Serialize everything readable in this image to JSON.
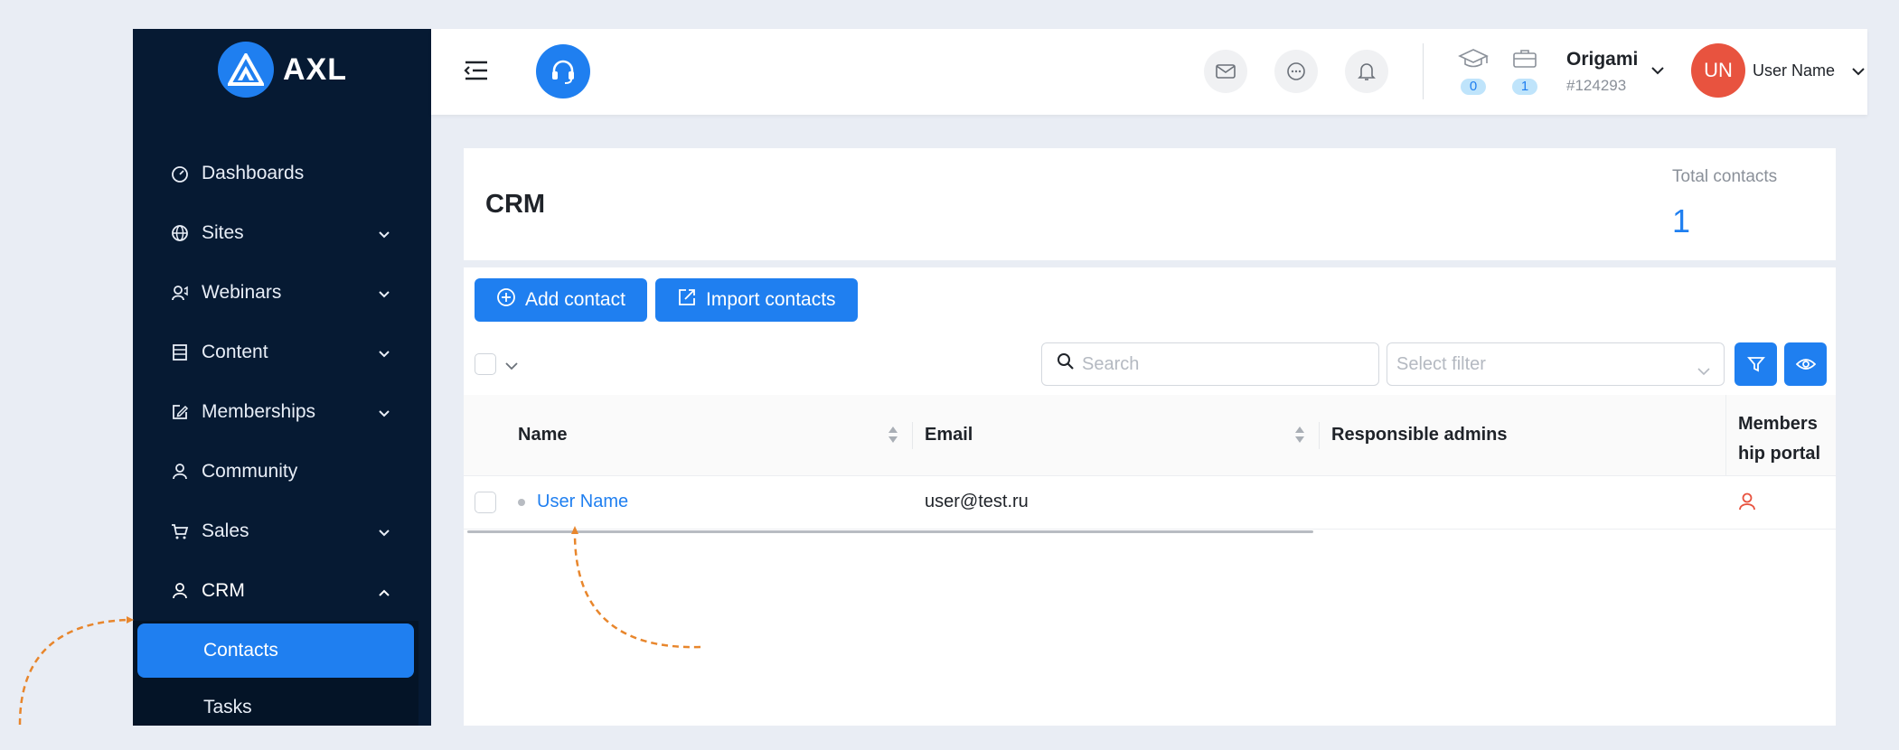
{
  "colors": {
    "accent": "#1f7ff0",
    "sidebar_bg": "#061a33",
    "avatar_bg": "#e8533f",
    "annotation_arrow": "#e8862c"
  },
  "brand": {
    "name": "AXL",
    "icon": "axl-triangle-logo"
  },
  "sidebar": {
    "items": [
      {
        "label": "Dashboards",
        "icon": "dashboard-icon",
        "has_chevron": false
      },
      {
        "label": "Sites",
        "icon": "globe-icon",
        "has_chevron": true
      },
      {
        "label": "Webinars",
        "icon": "webinar-icon",
        "has_chevron": true
      },
      {
        "label": "Content",
        "icon": "content-icon",
        "has_chevron": true
      },
      {
        "label": "Memberships",
        "icon": "edit-icon",
        "has_chevron": true
      },
      {
        "label": "Community",
        "icon": "user-icon",
        "has_chevron": false
      },
      {
        "label": "Sales",
        "icon": "cart-icon",
        "has_chevron": true
      },
      {
        "label": "CRM",
        "icon": "user-icon",
        "has_chevron": true,
        "expanded": true
      }
    ],
    "crm_sub": [
      {
        "label": "Contacts",
        "selected": true
      },
      {
        "label": "Tasks",
        "selected": false
      }
    ]
  },
  "header": {
    "stats": [
      {
        "icon": "graduation-cap-icon",
        "count": "0"
      },
      {
        "icon": "briefcase-icon",
        "count": "1"
      }
    ],
    "org": {
      "name": "Origami",
      "id": "#124293"
    },
    "user": {
      "initials": "UN",
      "name": "User Name"
    }
  },
  "page": {
    "title": "CRM",
    "total_label": "Total contacts",
    "total_value": "1"
  },
  "toolbar": {
    "add_contact": "Add contact",
    "import_contacts": "Import contacts",
    "search_placeholder": "Search",
    "filter_placeholder": "Select filter"
  },
  "table": {
    "columns": [
      "Name",
      "Email",
      "Responsible admins",
      "Members",
      "hip portal"
    ],
    "rows": [
      {
        "name": "User Name",
        "email": "user@test.ru",
        "responsible_admins": "",
        "membership_portal": "user-icon"
      }
    ]
  }
}
